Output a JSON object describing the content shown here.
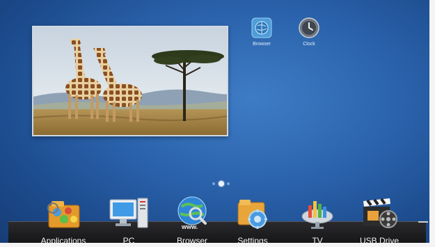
{
  "desktop": {
    "shortcuts": [
      {
        "label": "Browser",
        "icon": "browser-globe-icon"
      },
      {
        "label": "Clock",
        "icon": "clock-icon"
      }
    ],
    "page_indicator": {
      "pages": 3,
      "current": 2
    }
  },
  "widget": {
    "image": "giraffes-savanna-photo"
  },
  "dock": {
    "items": [
      {
        "label": "Applications",
        "icon": "applications-folder-icon"
      },
      {
        "label": "PC",
        "icon": "pc-monitor-icon"
      },
      {
        "label": "Browser",
        "icon": "browser-www-globe-icon"
      },
      {
        "label": "Settings",
        "icon": "settings-folder-icon"
      },
      {
        "label": "TV",
        "icon": "tv-satellite-dish-icon"
      },
      {
        "label": "USB Drive",
        "icon": "usb-drive-clapperboard-icon"
      }
    ]
  },
  "colors": {
    "background": "#2b64ad",
    "dock": "#1d1d1f"
  }
}
